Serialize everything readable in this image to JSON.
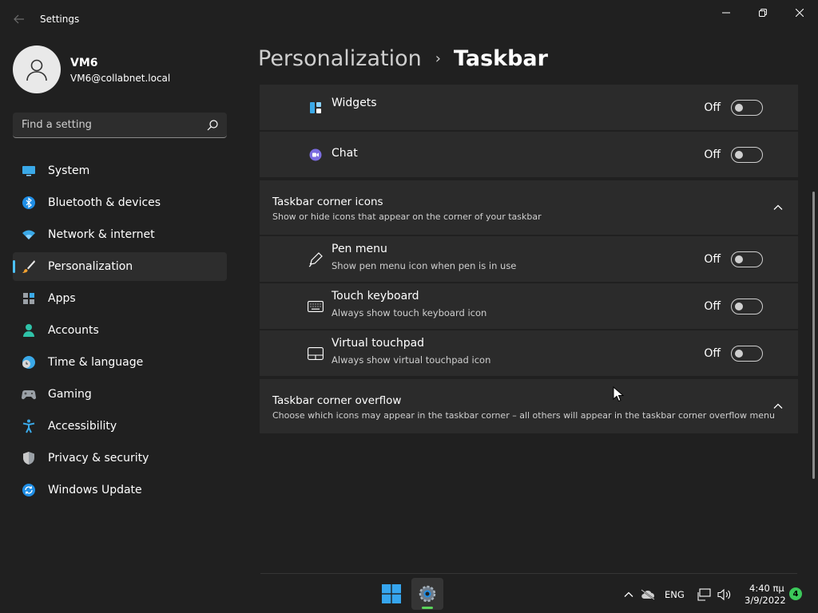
{
  "window": {
    "title": "Settings"
  },
  "profile": {
    "name": "VM6",
    "email": "VM6@collabnet.local"
  },
  "search": {
    "placeholder": "Find a setting"
  },
  "nav": {
    "items": [
      {
        "label": "System",
        "icon": "monitor-icon"
      },
      {
        "label": "Bluetooth & devices",
        "icon": "bluetooth-icon"
      },
      {
        "label": "Network & internet",
        "icon": "wifi-icon"
      },
      {
        "label": "Personalization",
        "icon": "brush-icon",
        "selected": true
      },
      {
        "label": "Apps",
        "icon": "apps-icon"
      },
      {
        "label": "Accounts",
        "icon": "person-icon"
      },
      {
        "label": "Time & language",
        "icon": "clock-globe-icon"
      },
      {
        "label": "Gaming",
        "icon": "gamepad-icon"
      },
      {
        "label": "Accessibility",
        "icon": "accessibility-icon"
      },
      {
        "label": "Privacy & security",
        "icon": "shield-icon"
      },
      {
        "label": "Windows Update",
        "icon": "update-icon"
      }
    ]
  },
  "header": {
    "parent": "Personalization",
    "separator": "›",
    "current": "Taskbar"
  },
  "content": {
    "widgets": {
      "title": "Widgets",
      "state": "Off"
    },
    "chat": {
      "title": "Chat",
      "state": "Off"
    },
    "corner_icons": {
      "title": "Taskbar corner icons",
      "description": "Show or hide icons that appear on the corner of your taskbar"
    },
    "pen_menu": {
      "title": "Pen menu",
      "description": "Show pen menu icon when pen is in use",
      "state": "Off"
    },
    "touch_keyboard": {
      "title": "Touch keyboard",
      "description": "Always show touch keyboard icon",
      "state": "Off"
    },
    "virtual_touchpad": {
      "title": "Virtual touchpad",
      "description": "Always show virtual touchpad icon",
      "state": "Off"
    },
    "corner_overflow": {
      "title": "Taskbar corner overflow",
      "description": "Choose which icons may appear in the taskbar corner – all others will appear in the taskbar corner overflow menu"
    }
  },
  "taskbar": {
    "language": "ENG",
    "time": "4:40 πμ",
    "date": "3/9/2022",
    "notification_count": "4"
  },
  "colors": {
    "accent": "#4cc2ff",
    "background": "#202020",
    "card": "#2b2b2b"
  }
}
